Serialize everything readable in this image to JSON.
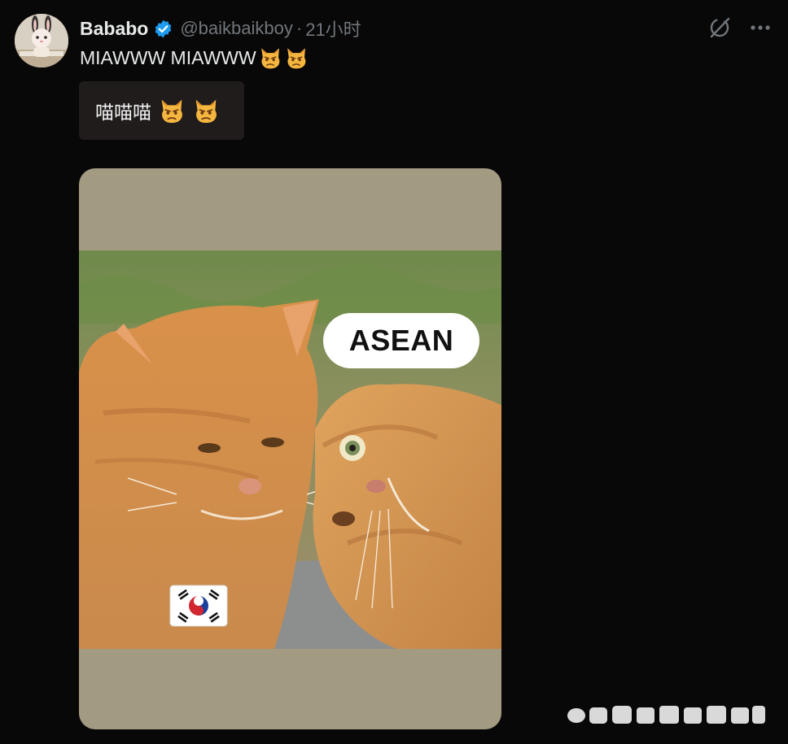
{
  "author": {
    "display_name": "Bababo",
    "handle": "@baikbaikboy",
    "separator": "·",
    "time": "21小时",
    "verified": true,
    "avatar_icon": "avatar-bunny-figure"
  },
  "actions": {
    "grok_icon": "grok-icon",
    "more_icon": "more-icon"
  },
  "tweet": {
    "text": "MIAWWW MIAWWW",
    "emojis": [
      "pouting-cat",
      "pouting-cat"
    ]
  },
  "translation": {
    "text": "喵喵喵",
    "emojis": [
      "pouting-cat",
      "pouting-cat"
    ]
  },
  "media": {
    "bubble_text": "ASEAN",
    "flag": "south-korea-flag"
  },
  "colors": {
    "background": "#080808",
    "verified_blue": "#1d9bf0",
    "media_bg": "#a39a82",
    "translation_bg": "#211c1c"
  }
}
